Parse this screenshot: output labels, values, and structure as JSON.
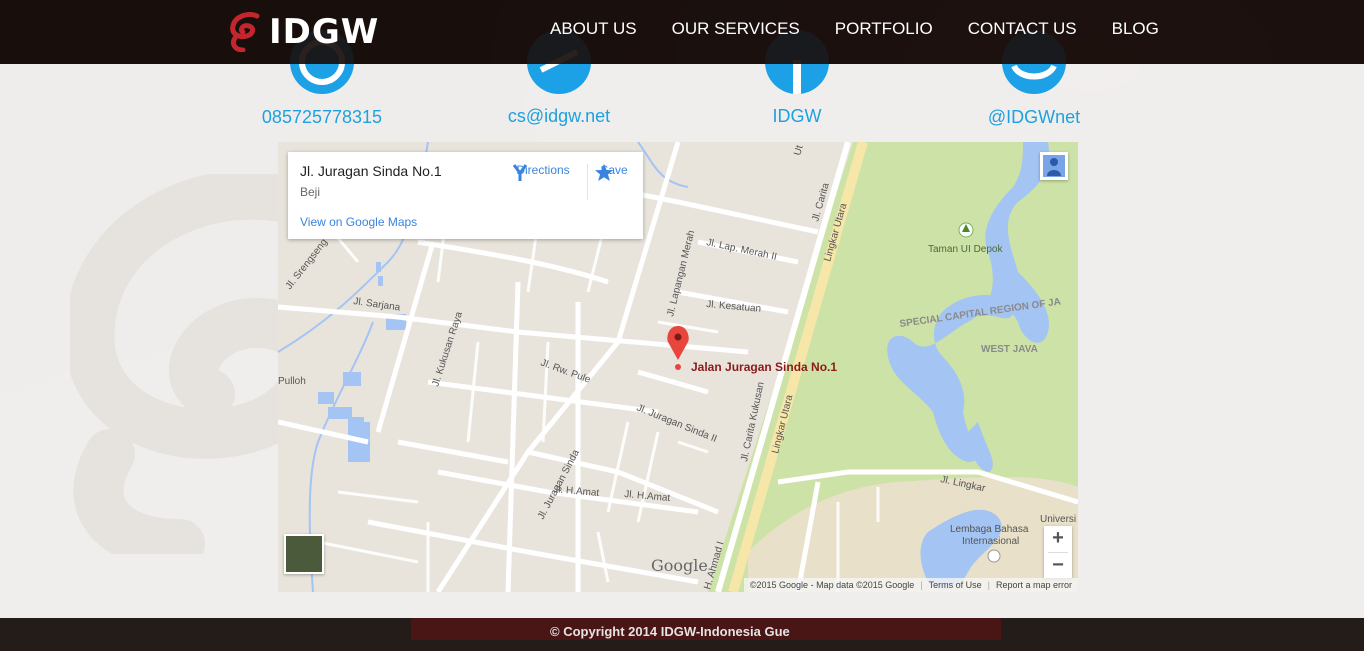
{
  "brand": {
    "logo_text": "IDGW",
    "accent_color": "#c4262e"
  },
  "nav": {
    "items": [
      {
        "label": "ABOUT US"
      },
      {
        "label": "OUR SERVICES"
      },
      {
        "label": "PORTFOLIO"
      },
      {
        "label": "CONTACT US"
      },
      {
        "label": "BLOG"
      }
    ]
  },
  "contacts": [
    {
      "icon": "whatsapp-icon",
      "label": "085725778315"
    },
    {
      "icon": "email-icon",
      "label": "cs@idgw.net"
    },
    {
      "icon": "facebook-icon",
      "label": "IDGW"
    },
    {
      "icon": "twitter-icon",
      "label": "@IDGWnet"
    }
  ],
  "contact_color": "#1ea1e0",
  "map": {
    "info_card": {
      "title": "Jl. Juragan Sinda No.1",
      "subtitle": "Beji",
      "link": "View on Google Maps",
      "directions": "Directions",
      "save": "Save"
    },
    "pin_label": "Jalan Juragan Sinda No.1",
    "watermark": "Google",
    "zoom_in": "+",
    "zoom_out": "−",
    "footer": {
      "data": "©2015 Google - Map data ©2015 Google",
      "terms": "Terms of Use",
      "report": "Report a map error"
    },
    "labels": {
      "l1": "Jl. Juragan Sinda",
      "l2": "Jl. Juragan Sinda II",
      "l3": "Jl. Lapangan Merah",
      "l4": "Jl. Lap. Merah II",
      "l5": "Jl. Kesatuan",
      "l6": "Jl. Rw. Pule",
      "l7": "Jl. Sarjana",
      "l8": "Jl. Kukusan Raya",
      "l9": "Jl. Srengseng Saw",
      "l10": "Jl. H.Amat",
      "l11": "Jl. H.Amat",
      "l12": "Jl. Carita Kukusan",
      "l13": "Lingkar Utara",
      "l14": "Lingkar Utara",
      "l15": "Jl. Carita",
      "l16": "Taman UI Depok",
      "l17": "SPECIAL CAPITAL REGION OF JA",
      "l18": "WEST JAVA",
      "l19": "Jl. Lingkar",
      "l20": "Lembaga Bahasa",
      "l21": "Internasional",
      "l22": "Universi",
      "l23": "Pulloh",
      "l24": "H. Ahmad I",
      "l25": "Ut"
    }
  },
  "footer": {
    "copyright": "© Copyright 2014 IDGW-Indonesia Gue"
  }
}
